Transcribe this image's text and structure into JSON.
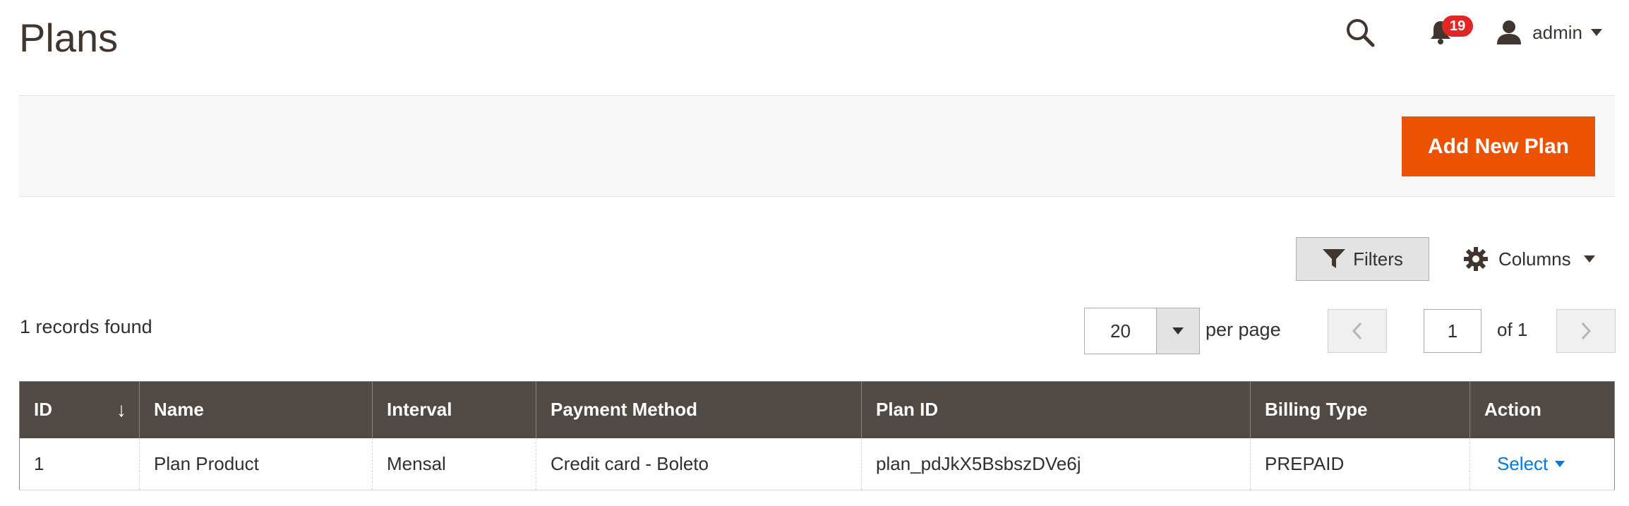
{
  "page": {
    "title": "Plans"
  },
  "header": {
    "notifications_count": "19",
    "user_name": "admin"
  },
  "actions": {
    "add_new_label": "Add New Plan"
  },
  "toolbar": {
    "filters_label": "Filters",
    "columns_label": "Columns",
    "records_found": "1 records found",
    "per_page_value": "20",
    "per_page_label": "per page",
    "current_page": "1",
    "total_pages_label": "of 1"
  },
  "grid": {
    "columns": [
      "ID",
      "Name",
      "Interval",
      "Payment Method",
      "Plan ID",
      "Billing Type",
      "Action"
    ],
    "sort_indicator": "↓",
    "rows": [
      {
        "id": "1",
        "name": "Plan Product",
        "interval": "Mensal",
        "payment_method": "Credit card - Boleto",
        "plan_id": "plan_pdJkX5BsbszDVe6j",
        "billing_type": "PREPAID",
        "action": "Select"
      }
    ]
  },
  "colors": {
    "accent_button": "#eb5202",
    "grid_header": "#514943",
    "link": "#007bdb",
    "badge": "#e22626"
  },
  "icons": [
    "search-icon",
    "bell-icon",
    "user-icon",
    "filter-icon",
    "gear-icon",
    "chevron-left-icon",
    "chevron-right-icon"
  ]
}
